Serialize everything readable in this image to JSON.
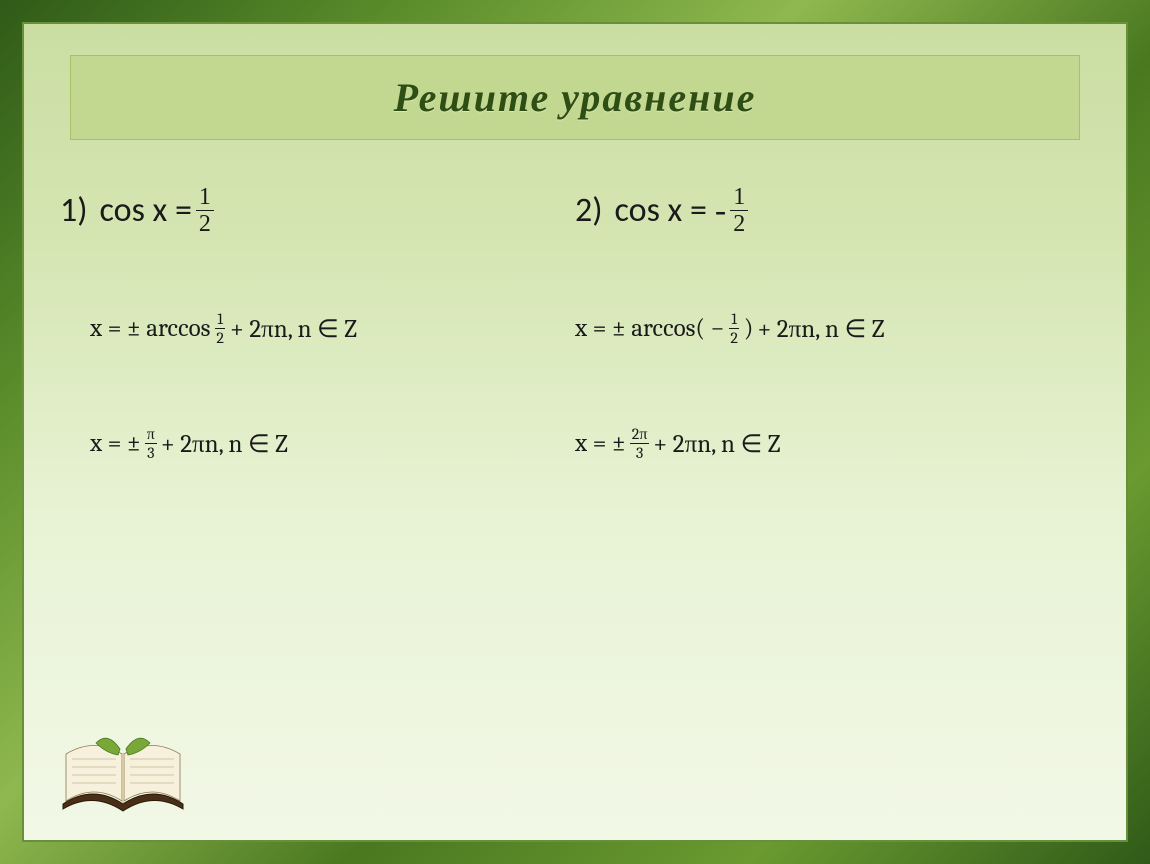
{
  "title": "Решите   уравнение",
  "problems": [
    {
      "number": "1)",
      "lhs": "cos x =",
      "rhs_sign": "",
      "rhs_num": "1",
      "rhs_den": "2"
    },
    {
      "number": "2)",
      "lhs": "cos x =",
      "rhs_sign": "-",
      "rhs_num": "1",
      "rhs_den": "2"
    }
  ],
  "solutions": {
    "left": [
      {
        "prefix": "x =  ± arccos",
        "frac_num": "1",
        "frac_den": "2",
        "suffix": "+  2πn, n ∈ Z"
      },
      {
        "prefix": "x =  ±",
        "frac_num": "π",
        "frac_den": "3",
        "suffix": "+  2πn, n ∈ Z"
      }
    ],
    "right": [
      {
        "prefix": "x =  ± arccos( −",
        "frac_num": "1",
        "frac_den": "2",
        "mid_close": ")",
        "suffix": "+ 2πn, n ∈ Z"
      },
      {
        "prefix": "x =  ±",
        "frac_num": "2π",
        "frac_den": "3",
        "suffix": "+  2πn, n ∈ Z"
      }
    ]
  }
}
